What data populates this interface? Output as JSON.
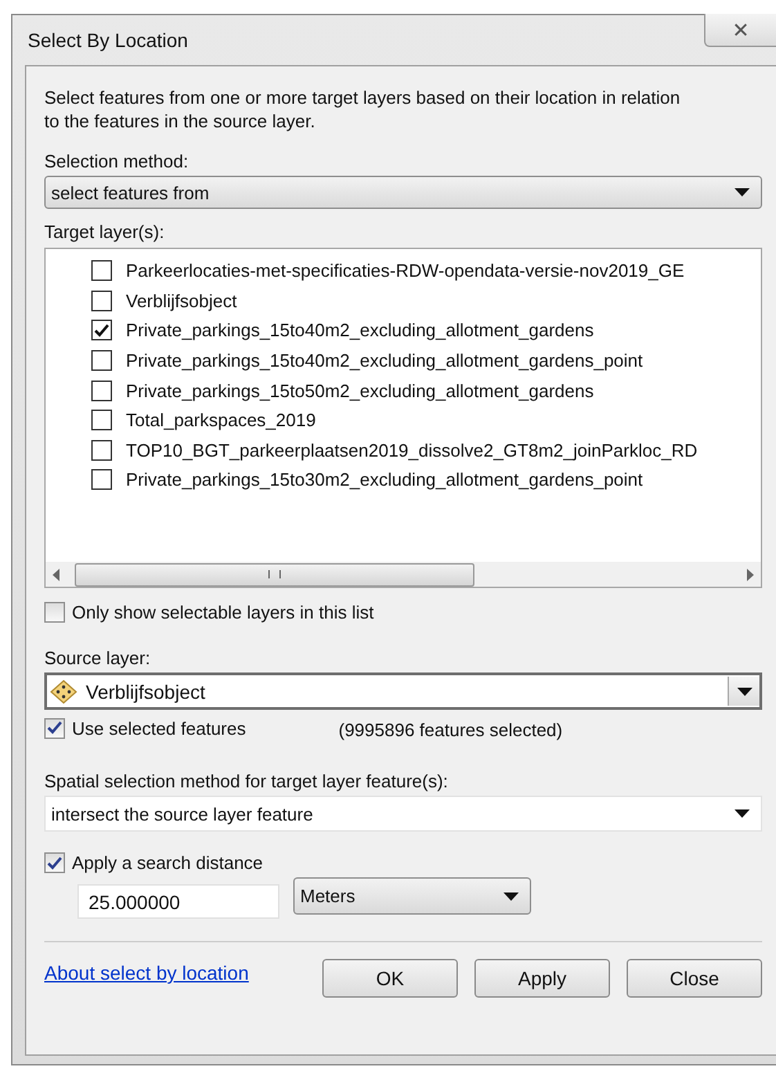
{
  "window": {
    "title": "Select By Location",
    "close": "✕"
  },
  "description": "Select features from one or more target layers based on their location in relation to the features in the source layer.",
  "selection_method": {
    "label": "Selection method:",
    "value": "select features from"
  },
  "target_layers": {
    "label": "Target layer(s):",
    "items": [
      {
        "name": "Parkeerlocaties-met-specificaties-RDW-opendata-versie-nov2019_GE",
        "checked": false
      },
      {
        "name": "Verblijfsobject",
        "checked": false
      },
      {
        "name": "Private_parkings_15to40m2_excluding_allotment_gardens",
        "checked": true
      },
      {
        "name": "Private_parkings_15to40m2_excluding_allotment_gardens_point",
        "checked": false
      },
      {
        "name": "Private_parkings_15to50m2_excluding_allotment_gardens",
        "checked": false
      },
      {
        "name": "Total_parkspaces_2019",
        "checked": false
      },
      {
        "name": "TOP10_BGT_parkeerplaatsen2019_dissolve2_GT8m2_joinParkloc_RD",
        "checked": false
      },
      {
        "name": "Private_parkings_15to30m2_excluding_allotment_gardens_point",
        "checked": false
      }
    ]
  },
  "only_selectable": {
    "label": "Only show selectable layers in this list",
    "checked": false
  },
  "source_layer": {
    "label": "Source layer:",
    "value": "Verblijfsobject"
  },
  "use_selected": {
    "label": "Use selected features",
    "checked": true,
    "count": "(9995896 features selected)"
  },
  "spatial_method": {
    "label": "Spatial selection method for target layer feature(s):",
    "value": "intersect the source layer feature"
  },
  "search_distance": {
    "label": "Apply a search distance",
    "checked": true,
    "value": "25.000000",
    "unit": "Meters"
  },
  "link": "About select by location",
  "buttons": [
    "OK",
    "Apply",
    "Close"
  ]
}
